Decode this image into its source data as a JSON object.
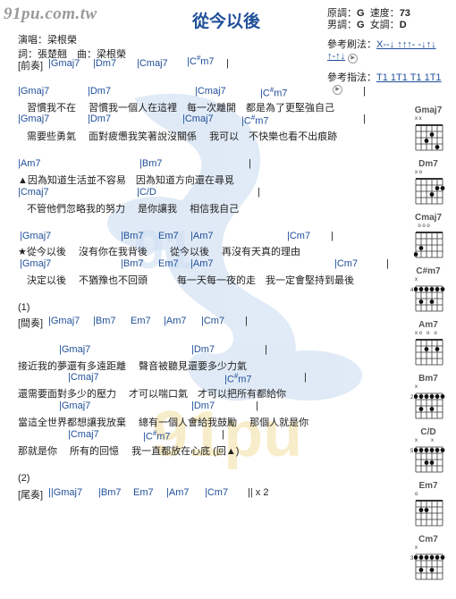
{
  "header": {
    "logo": "91pu.com.tw",
    "title": "從今以後",
    "singer": "演唱：梁根榮",
    "credits": "詞：張楚翹　曲：梁根榮",
    "original_key_label": "原調：",
    "original_key": "G",
    "tempo_label": "速度：",
    "tempo": "73",
    "male_key_label": "男調：",
    "male_key": "G",
    "female_key_label": "女調：",
    "female_key": "D",
    "strum_label": "參考刷法：",
    "strum_part1": "X--↓ ↑↑↑- -↓↑↓",
    "strum_part2": "↑-↑↓",
    "pick_label": "參考指法：",
    "pick_pattern": "T1 1T1 T1 1T1"
  },
  "sheet": {
    "intro_label": "[前奏]",
    "l01_c": [
      "|Gmaj7",
      "|Dm7",
      "|Cmaj7",
      "|C#m7",
      "|"
    ],
    "l02_c": [
      "|Gmaj7",
      "|Dm7",
      "|Cmaj7",
      "|C#m7",
      "|"
    ],
    "l03": "習慣我不在　 習慣我一個人在這裡　每一次離開　都是為了更堅強自己",
    "l04_c": [
      "|Gmaj7",
      "|Dm7",
      "|Cmaj7",
      "|C#m7",
      "|"
    ],
    "l05": "需要些勇氣　 面對疲憊我笑著說沒關係　 我可以　不快樂也看不出痕跡",
    "l06_c": [
      "|Am7",
      "|Bm7",
      "|"
    ],
    "l07": "▲因為知道生活並不容易　因為知道方向還在尋覓",
    "l08_c": [
      "|Cmaj7",
      "|C/D",
      "|"
    ],
    "l09": "不管他們忽略我的努力　 是你讓我　 相信我自己",
    "l10_c": [
      "|Gmaj7",
      "|Bm7",
      "Em7",
      "|Am7",
      "|Cm7",
      "|"
    ],
    "l11": "★從今以後　 沒有你在我背後　　 從今以後　 再沒有天真的理由",
    "l12_c": [
      "|Gmaj7",
      "|Bm7",
      "Em7",
      "|Am7",
      "|Cm7",
      "|"
    ],
    "l13": "決定以後　 不猶豫也不回頭　　　每一天每一夜的走　我一定會堅持到最後",
    "mark1": "(1)",
    "interlude_label": "[間奏]",
    "l14_c": [
      "|Gmaj7",
      "|Bm7",
      "Em7",
      "|Am7",
      "|Cm7",
      "|"
    ],
    "l15_c": [
      "|Gmaj7",
      "|Dm7",
      "|"
    ],
    "l16": "接近我的夢還有多遠距離　 聲音被聽見還要多少力氣",
    "l17_c": [
      "|Cmaj7",
      "|C#m7",
      "|"
    ],
    "l18": "還需要面對多少的壓力　 才可以喘口氣　才可以把所有都給你",
    "l19_c": [
      "|Gmaj7",
      "|Dm7",
      "|"
    ],
    "l20": "當這全世界都想讓我放棄　 總有一個人會給我鼓勵　 那個人就是你",
    "l21_c": [
      "|Cmaj7",
      "|C#m7",
      "|"
    ],
    "l22": "那就是你　 所有的回憶　 我一直都放在心底 (回▲)",
    "mark2": "(2)",
    "outro_label": "[尾奏]",
    "l23_c": [
      "||Gmaj7",
      "|Bm7",
      "Em7",
      "|Am7",
      "|Cm7",
      "|| x 2"
    ]
  },
  "chord_diagrams": [
    {
      "name": "Gmaj7",
      "top": "x x",
      "fret": ""
    },
    {
      "name": "Dm7",
      "top": "x o",
      "fret": ""
    },
    {
      "name": "Cmaj7",
      "top": "  o o o",
      "fret": ""
    },
    {
      "name": "C#m7",
      "top": "x",
      "fret": "4"
    },
    {
      "name": "Am7",
      "top": "x o   o   o",
      "fret": ""
    },
    {
      "name": "Bm7",
      "top": "x",
      "fret": "2"
    },
    {
      "name": "C/D",
      "top": "x         x",
      "fret": "5"
    },
    {
      "name": "Em7",
      "top": "o",
      "fret": ""
    },
    {
      "name": "Cm7",
      "top": "x",
      "fret": "3"
    }
  ],
  "colors": {
    "chord": "#1f4f99",
    "text": "#222222",
    "logo": "#9a9a9a",
    "watermark": "#c9dcf2"
  }
}
